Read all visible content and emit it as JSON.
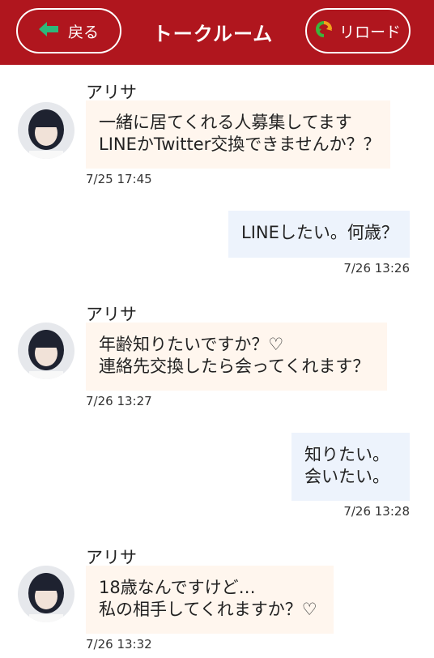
{
  "header": {
    "back_label": "戻る",
    "title": "トークルーム",
    "reload_label": "リロード",
    "bg_color": "#b0161e",
    "back_icon": "arrow-left-icon",
    "reload_icon": "refresh-icon"
  },
  "messages": [
    {
      "direction": "incoming",
      "sender": "アリサ",
      "lines": [
        "一緒に居てくれる人募集してます",
        "LINEかTwitter交換できませんか？？"
      ],
      "time": "7/25 17:45"
    },
    {
      "direction": "outgoing",
      "lines": [
        "LINEしたい。何歳？"
      ],
      "time": "7/26 13:26"
    },
    {
      "direction": "incoming",
      "sender": "アリサ",
      "lines": [
        "年齢知りたいですか？♡",
        "連絡先交換したら会ってくれます？"
      ],
      "time": "7/26 13:27"
    },
    {
      "direction": "outgoing",
      "lines": [
        "知りたい。",
        "会いたい。"
      ],
      "time": "7/26 13:28"
    },
    {
      "direction": "incoming",
      "sender": "アリサ",
      "lines": [
        "18歳なんですけど…",
        "私の相手してくれますか？♡"
      ],
      "time": "7/26 13:32"
    }
  ],
  "colors": {
    "incoming_bubble": "#fff6ee",
    "outgoing_bubble": "#edf3fc"
  }
}
